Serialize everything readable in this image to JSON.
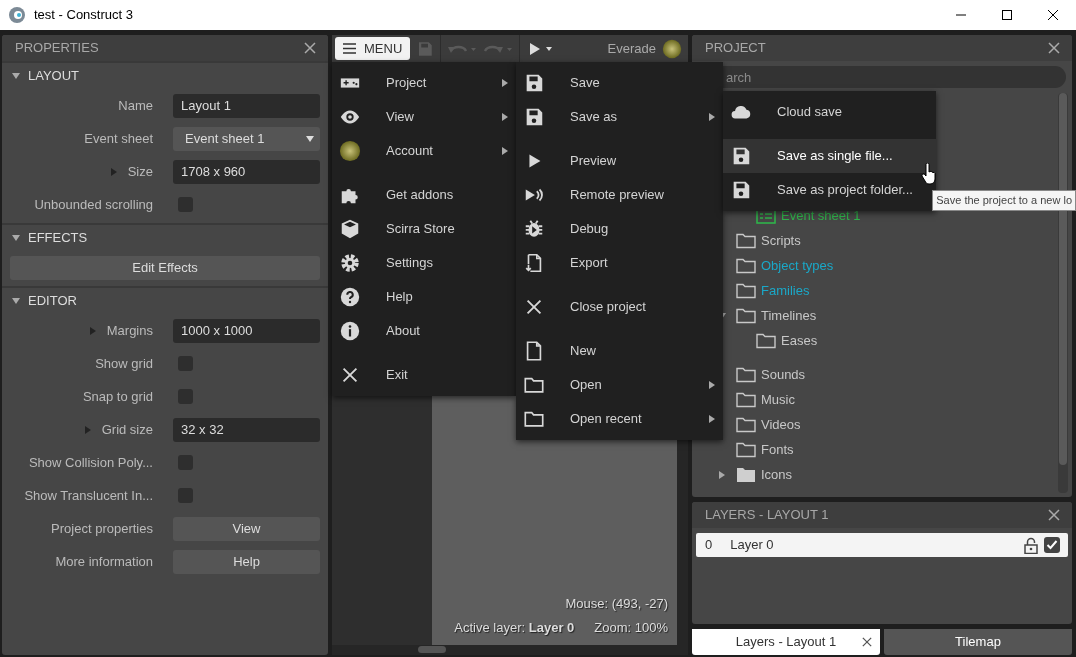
{
  "window": {
    "title": "test - Construct 3"
  },
  "properties": {
    "title": "PROPERTIES",
    "sections": [
      {
        "title": "LAYOUT",
        "expanded": true,
        "rows": [
          {
            "kind": "text",
            "label": "Name",
            "value": "Layout 1",
            "expandable": false
          },
          {
            "kind": "select",
            "label": "Event sheet",
            "value": "Event sheet 1",
            "expandable": false
          },
          {
            "kind": "text",
            "label": "Size",
            "value": "1708 x 960",
            "expandable": true
          },
          {
            "kind": "checkbox",
            "label": "Unbounded scrolling",
            "checked": false,
            "expandable": false
          }
        ]
      },
      {
        "title": "EFFECTS",
        "expanded": true,
        "rows": [
          {
            "kind": "wide_button",
            "label": "Edit Effects"
          }
        ]
      },
      {
        "title": "EDITOR",
        "expanded": true,
        "rows": [
          {
            "kind": "text",
            "label": "Margins",
            "value": "1000 x 1000",
            "expandable": true
          },
          {
            "kind": "checkbox",
            "label": "Show grid",
            "checked": false,
            "expandable": false
          },
          {
            "kind": "checkbox",
            "label": "Snap to grid",
            "checked": false,
            "expandable": false
          },
          {
            "kind": "text",
            "label": "Grid size",
            "value": "32 x 32",
            "expandable": true
          },
          {
            "kind": "checkbox",
            "label": "Show Collision Poly...",
            "checked": false,
            "expandable": false
          },
          {
            "kind": "checkbox",
            "label": "Show Translucent In...",
            "checked": false,
            "expandable": false
          },
          {
            "kind": "button",
            "label": "Project properties",
            "value": "View",
            "expandable": false
          },
          {
            "kind": "button",
            "label": "More information",
            "value": "Help",
            "expandable": false
          }
        ]
      }
    ]
  },
  "toolbar": {
    "menu_button": "MENU",
    "user": "Everade"
  },
  "status": {
    "mouse": "Mouse: (493, -27)",
    "active_layer": "Active layer: **Layer 0**",
    "zoom": "Zoom: 100%"
  },
  "main_menu": {
    "groups": [
      [
        {
          "label": "Project",
          "submenu": true
        },
        {
          "label": "View",
          "submenu": true
        },
        {
          "label": "Account",
          "submenu": true
        }
      ],
      [
        {
          "label": "Get addons",
          "submenu": false
        },
        {
          "label": "Scirra Store",
          "submenu": false
        },
        {
          "label": "Settings",
          "submenu": false
        },
        {
          "label": "Help",
          "submenu": false
        },
        {
          "label": "About",
          "submenu": false
        }
      ],
      [
        {
          "label": "Exit",
          "submenu": false
        }
      ]
    ]
  },
  "project_menu": {
    "groups": [
      [
        {
          "label": "Save",
          "submenu": false
        },
        {
          "label": "Save as",
          "submenu": true
        }
      ],
      [
        {
          "label": "Preview",
          "submenu": false
        },
        {
          "label": "Remote preview",
          "submenu": false
        },
        {
          "label": "Debug",
          "submenu": false
        },
        {
          "label": "Export",
          "submenu": false
        }
      ],
      [
        {
          "label": "Close project",
          "submenu": false
        }
      ],
      [
        {
          "label": "New",
          "submenu": false
        },
        {
          "label": "Open",
          "submenu": true
        },
        {
          "label": "Open recent",
          "submenu": true
        }
      ]
    ]
  },
  "save_as_menu": {
    "groups": [
      [
        {
          "label": "Cloud save",
          "submenu": false,
          "highlighted": false
        }
      ],
      [
        {
          "label": "Save as single file...",
          "submenu": false,
          "highlighted": true
        },
        {
          "label": "Save as project folder...",
          "submenu": false,
          "highlighted": false
        }
      ]
    ]
  },
  "tooltip": "Save the project to a new lo",
  "project": {
    "title": "PROJECT",
    "search": {
      "placeholder": "arch"
    },
    "tree": [
      {
        "label": "Event sheet 1",
        "kind": "event_sheet",
        "color": "#2fb34a"
      },
      {
        "label": "Scripts",
        "kind": "folder",
        "color": "#c8c8c8"
      },
      {
        "label": "Object types",
        "kind": "folder",
        "color": "#1aa8c8"
      },
      {
        "label": "Families",
        "kind": "folder",
        "color": "#1aa8c8"
      },
      {
        "label": "Timelines",
        "kind": "folder",
        "color": "#c8c8c8",
        "expanded": true,
        "children": [
          {
            "label": "Eases",
            "kind": "folder",
            "color": "#c8c8c8"
          }
        ]
      },
      {
        "label": "Sounds",
        "kind": "folder",
        "color": "#c8c8c8"
      },
      {
        "label": "Music",
        "kind": "folder",
        "color": "#c8c8c8"
      },
      {
        "label": "Videos",
        "kind": "folder",
        "color": "#c8c8c8"
      },
      {
        "label": "Fonts",
        "kind": "folder",
        "color": "#c8c8c8"
      },
      {
        "label": "Icons",
        "kind": "folder",
        "color": "#c8c8c8",
        "expanded": false
      }
    ]
  },
  "layers": {
    "title": "LAYERS - LAYOUT 1",
    "rows": [
      {
        "index": "0",
        "name": "Layer 0",
        "locked": false,
        "visible": true
      }
    ]
  },
  "bottom_tabs": [
    {
      "label": "Layers - Layout 1",
      "selected": true,
      "closable": true
    },
    {
      "label": "Tilemap",
      "selected": false,
      "closable": false
    }
  ]
}
